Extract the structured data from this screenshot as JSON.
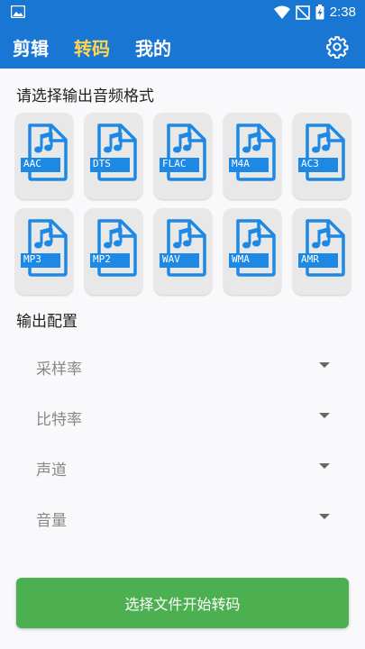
{
  "status_bar": {
    "time": "2:38",
    "icons": [
      "image-icon",
      "wifi-icon",
      "no-signal-icon",
      "battery-charging-icon"
    ]
  },
  "app_bar": {
    "tabs": [
      {
        "label": "剪辑",
        "active": false
      },
      {
        "label": "转码",
        "active": true
      },
      {
        "label": "我的",
        "active": false
      }
    ],
    "settings_icon": "gear-icon",
    "background": "#1976d2",
    "active_tab_color": "#ffd54f"
  },
  "format_section": {
    "title": "请选择输出音频格式",
    "formats": [
      "AAC",
      "DTS",
      "FLAC",
      "M4A",
      "AC3",
      "MP3",
      "MP2",
      "WAV",
      "WMA",
      "AMR"
    ],
    "file_icon": "audio-file-icon",
    "icon_color": "#1e88e5"
  },
  "output_config": {
    "title": "输出配置",
    "fields": [
      {
        "label": "采样率"
      },
      {
        "label": "比特率"
      },
      {
        "label": "声道"
      },
      {
        "label": "音量"
      }
    ]
  },
  "action_button": {
    "label": "选择文件开始转码",
    "color": "#4caf50"
  }
}
